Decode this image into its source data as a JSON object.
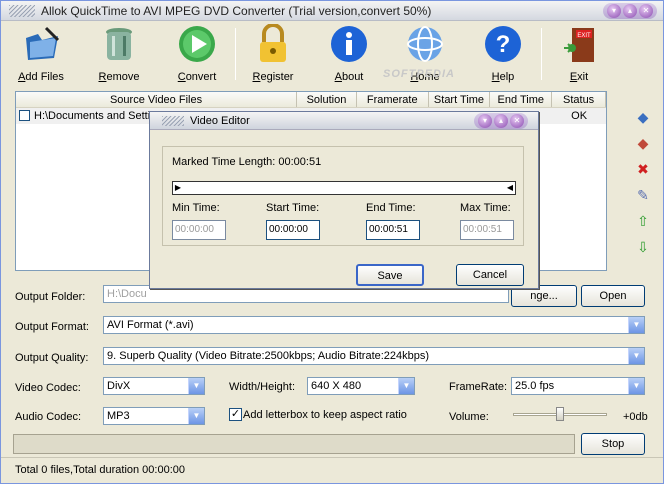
{
  "window": {
    "title": "Allok QuickTime to AVI MPEG DVD Converter (Trial version,convert 50%)"
  },
  "toolbar": {
    "add_files": "Add Files",
    "remove": "Remove",
    "convert": "Convert",
    "register": "Register",
    "about": "About",
    "home": "Home",
    "help": "Help",
    "exit": "Exit",
    "watermark": "SOFTPEDIA"
  },
  "file_list": {
    "columns": [
      "Source Video Files",
      "Solution",
      "Framerate",
      "Start Time",
      "End Time",
      "Status"
    ],
    "rows": [
      {
        "file": "H:\\Documents and Settin",
        "status": "OK"
      }
    ]
  },
  "output": {
    "folder_label": "Output Folder:",
    "folder_value": "H:\\Docu",
    "change_label": "nge...",
    "open_label": "Open",
    "format_label": "Output Format:",
    "format_value": "AVI Format (*.avi)",
    "quality_label": "Output Quality:",
    "quality_value": "9. Superb Quality  (Video Bitrate:2500kbps; Audio Bitrate:224kbps)",
    "video_codec_label": "Video Codec:",
    "video_codec_value": "DivX",
    "wh_label": "Width/Height:",
    "wh_value": "640 X 480",
    "framerate_label": "FrameRate:",
    "framerate_value": "25.0  fps",
    "audio_codec_label": "Audio Codec:",
    "audio_codec_value": "MP3",
    "letterbox_label": "Add letterbox to keep aspect ratio",
    "letterbox_checked": true,
    "volume_label": "Volume:",
    "volume_value": "+0db",
    "stop_label": "Stop"
  },
  "status_bar": {
    "text": "Total 0 files,Total duration 00:00:00"
  },
  "dialog": {
    "title": "Video Editor",
    "marked_label": "Marked Time Length: 00:00:51",
    "min_label": "Min Time:",
    "start_label": "Start Time:",
    "end_label": "End Time:",
    "max_label": "Max Time:",
    "min_value": "00:00:00",
    "start_value": "00:00:00",
    "end_value": "00:00:51",
    "max_value": "00:00:51",
    "save_label": "Save",
    "cancel_label": "Cancel"
  },
  "colors": {
    "accent": "#1c5180",
    "window_bg": "#ece9d8"
  }
}
